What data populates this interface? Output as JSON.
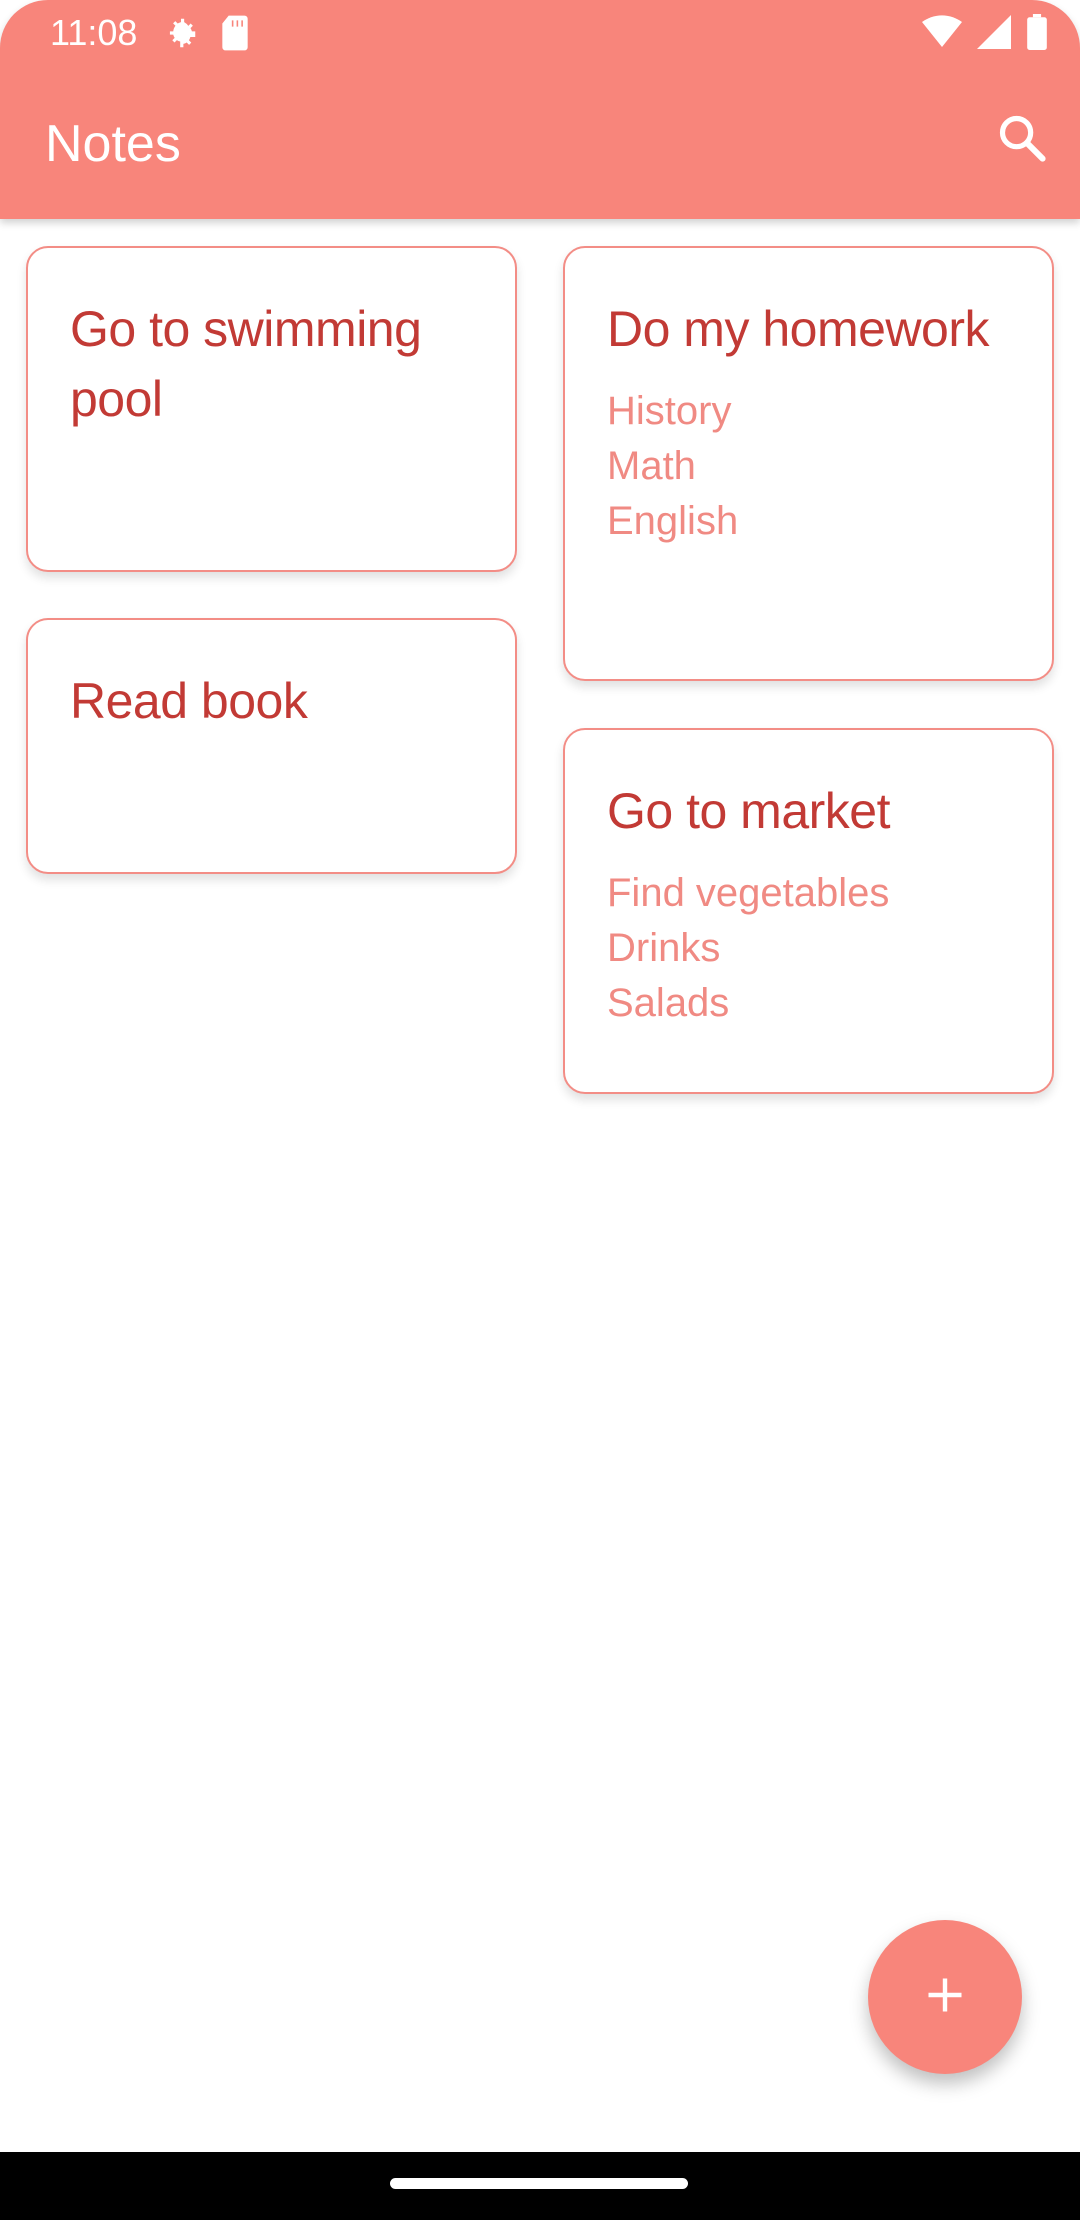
{
  "status_bar": {
    "time": "11:08",
    "icons_left": [
      "settings-gear-icon",
      "sd-card-icon"
    ],
    "icons_right": [
      "wifi-icon",
      "signal-icon",
      "battery-icon"
    ]
  },
  "app_bar": {
    "title": "Notes",
    "action_icon": "search-icon",
    "color": "#f8857b"
  },
  "notes": [
    {
      "title": "Go to swimming pool",
      "lines": []
    },
    {
      "title": "Do my homework",
      "lines": [
        "History",
        "Math",
        "English"
      ]
    },
    {
      "title": "Read book",
      "lines": []
    },
    {
      "title": "Go to market",
      "lines": [
        "Find vegetables",
        "Drinks",
        "Salads"
      ]
    }
  ],
  "fab": {
    "icon": "plus-icon"
  },
  "colors": {
    "accent": "#f8857b",
    "title_text": "#c23a35",
    "body_text": "#f08a83",
    "card_border": "#f38d86"
  }
}
